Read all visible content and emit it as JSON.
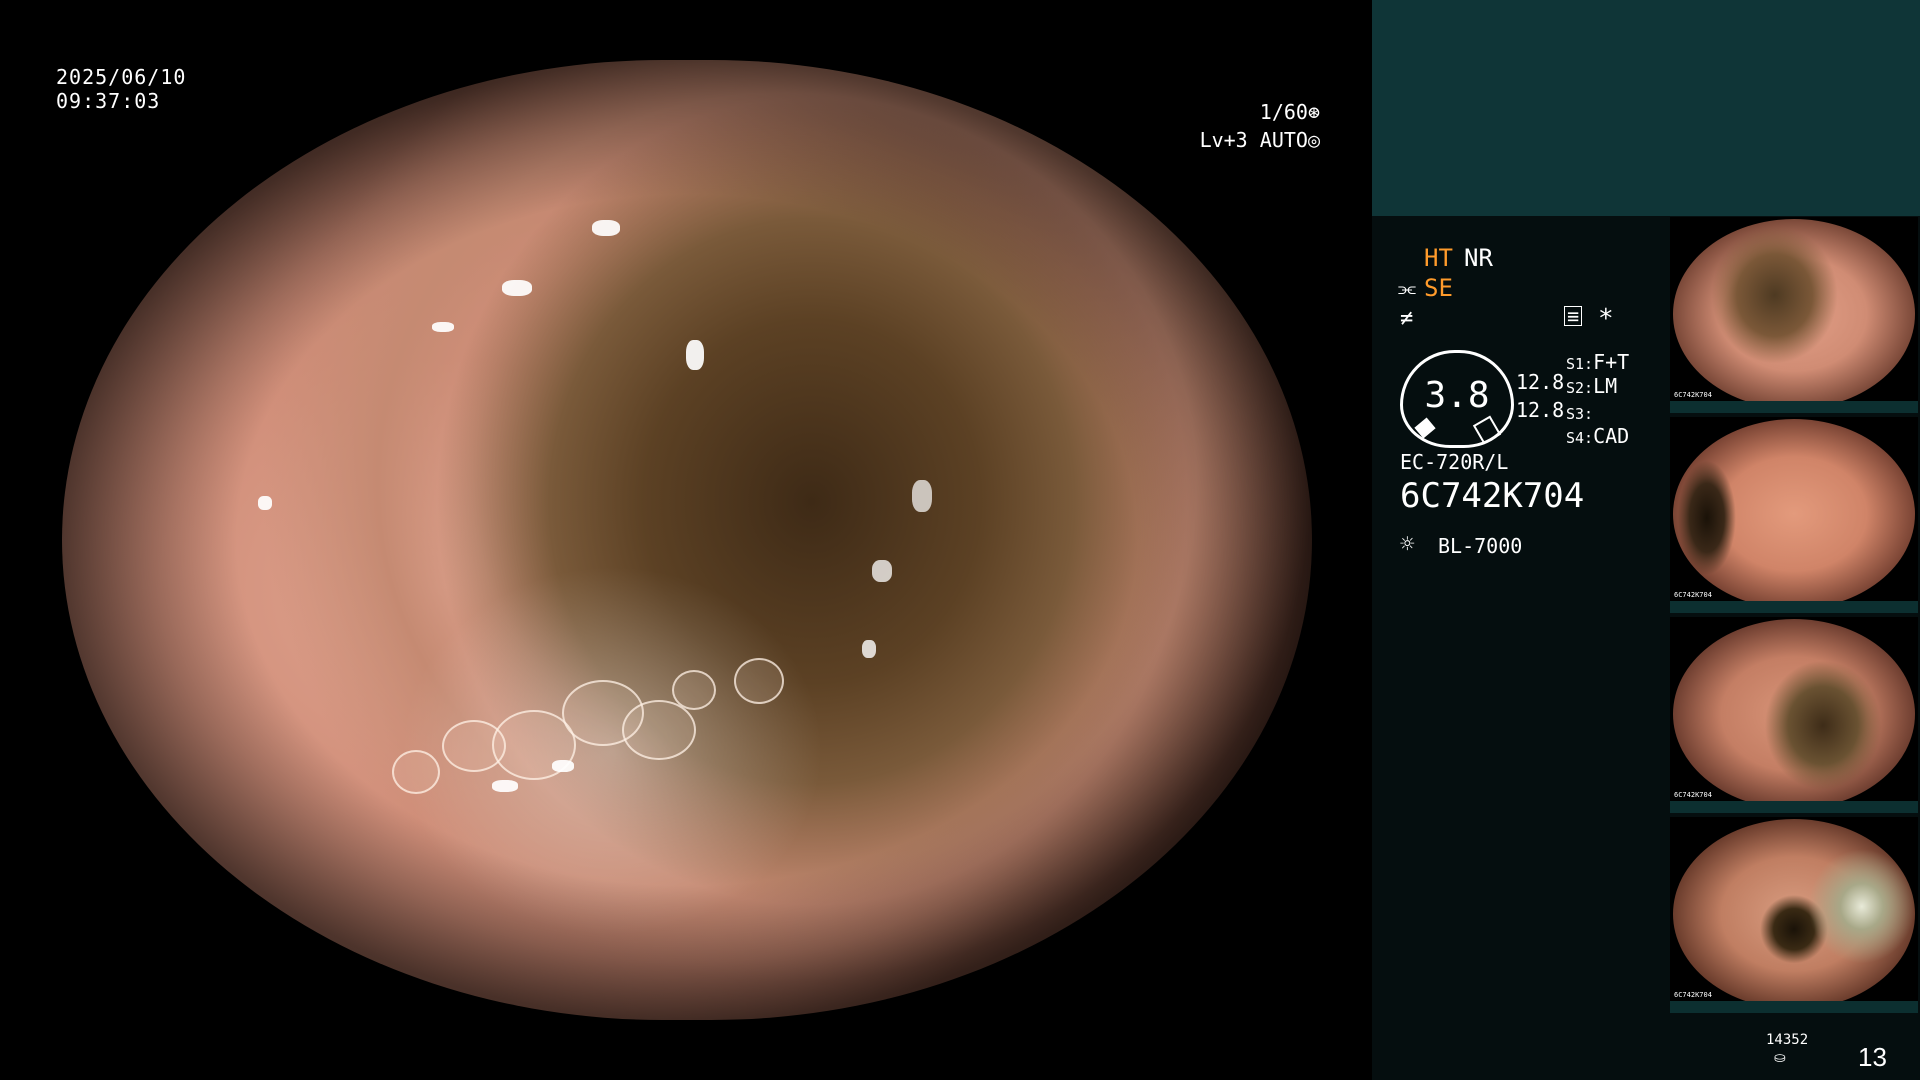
{
  "overlay": {
    "date": "2025/06/10",
    "time": "09:37:03",
    "shutter": "1/60",
    "shutter_icon": "aperture-icon",
    "level": "Lv+3",
    "mode": "AUTO",
    "mode_icon": "iris-icon"
  },
  "panel": {
    "ht_label": "HT",
    "nr_label": "NR",
    "se_label": "SE",
    "se_icon": "scissors-icon",
    "freeze_icon": "freeze-icon",
    "memo_icon": "memo-icon",
    "star_label": "*",
    "gauge_value": "3.8",
    "zoom_a": "12.8",
    "zoom_b": "12.8",
    "switches": [
      {
        "key": "S1:",
        "value": "F+T"
      },
      {
        "key": "S2:",
        "value": "LM"
      },
      {
        "key": "S3:",
        "value": ""
      },
      {
        "key": "S4:",
        "value": "CAD"
      }
    ],
    "scope_model": "EC-720R/L",
    "serial": "6C742K704",
    "light_source_icon": "light-source-icon",
    "light_source": "BL-7000",
    "storage_count": "14352",
    "storage_icon": "storage-icon",
    "image_count": "13"
  },
  "thumbnails": [
    {
      "label": "6C742K704"
    },
    {
      "label": "6C742K704"
    },
    {
      "label": "6C742K704"
    },
    {
      "label": "6C742K704"
    }
  ],
  "colors": {
    "panel_bg": "#050e0f",
    "panel_top": "#0f3537",
    "accent": "#ff9b2b"
  }
}
